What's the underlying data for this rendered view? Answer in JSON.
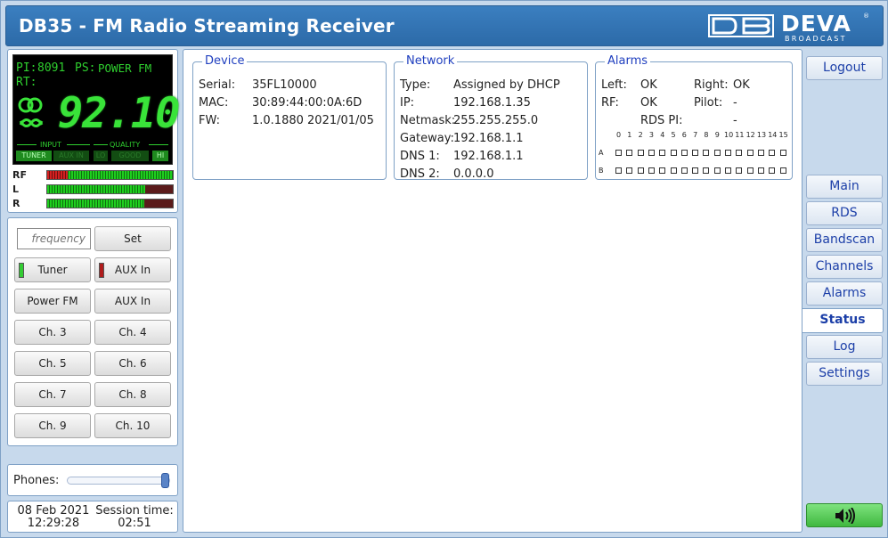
{
  "header": {
    "title": "DB35 - FM Radio Streaming Receiver",
    "logo_text": "DEVA",
    "logo_sub": "BROADCAST",
    "logo_reg": "®"
  },
  "lcd": {
    "pi_label": "PI:",
    "pi_value": "8091",
    "ps_label": "PS:",
    "ps_value": "POWER FM",
    "rt_label": "RT:",
    "frequency": "92.10",
    "input_label": "INPUT",
    "quality_label": "QUALITY",
    "tuner": "TUNER",
    "aux_in": "AUX IN",
    "lo": "LO",
    "good": "GOOD",
    "hi": "HI"
  },
  "meters": [
    {
      "label": "RF",
      "level": 0.16,
      "color": "red"
    },
    {
      "label": "L",
      "level": 0.78,
      "color": "green"
    },
    {
      "label": "R",
      "level": 0.77,
      "color": "green"
    }
  ],
  "controls": {
    "frequency_placeholder": "frequency",
    "set": "Set",
    "tuner": "Tuner",
    "aux_in_toggle": "AUX In",
    "presets": [
      "Power FM",
      "AUX In",
      "Ch. 3",
      "Ch. 4",
      "Ch. 5",
      "Ch. 6",
      "Ch. 7",
      "Ch. 8",
      "Ch. 9",
      "Ch. 10"
    ],
    "tuner_led_color": "#33cc33",
    "aux_led_color": "#b01c1c"
  },
  "phones": {
    "label": "Phones:",
    "level": 0.95
  },
  "clock": {
    "date": "08 Feb 2021",
    "time": "12:29:28",
    "session_label": "Session time:",
    "session_time": "02:51"
  },
  "device": {
    "legend": "Device",
    "serial_label": "Serial:",
    "serial": "35FL10000",
    "mac_label": "MAC:",
    "mac": "30:89:44:00:0A:6D",
    "fw_label": "FW:",
    "fw": "1.0.1880 2021/01/05"
  },
  "network": {
    "legend": "Network",
    "type_label": "Type:",
    "type": "Assigned by DHCP",
    "ip_label": "IP:",
    "ip": "192.168.1.35",
    "netmask_label": "Netmask:",
    "netmask": "255.255.255.0",
    "gateway_label": "Gateway:",
    "gateway": "192.168.1.1",
    "dns1_label": "DNS 1:",
    "dns1": "192.168.1.1",
    "dns2_label": "DNS 2:",
    "dns2": "0.0.0.0"
  },
  "alarms": {
    "legend": "Alarms",
    "left_label": "Left:",
    "left": "OK",
    "right_label": "Right:",
    "right": "OK",
    "rf_label": "RF:",
    "rf": "OK",
    "pilot_label": "Pilot:",
    "pilot": "-",
    "rds_pi_label": "RDS PI:",
    "rds_pi": "-",
    "indices": [
      "0",
      "1",
      "2",
      "3",
      "4",
      "5",
      "6",
      "7",
      "8",
      "9",
      "10",
      "11",
      "12",
      "13",
      "14",
      "15"
    ],
    "row_a": "A",
    "row_b": "B"
  },
  "nav": {
    "logout": "Logout",
    "items": [
      "Main",
      "RDS",
      "Bandscan",
      "Channels",
      "Alarms",
      "Status",
      "Log",
      "Settings"
    ],
    "active": "Status",
    "speaker": "speaker-icon"
  },
  "colors": {
    "header_bg": "#2f70ae",
    "lcd_green": "#39e339",
    "nav_text": "#1c3fa8",
    "speaker_green": "#4cc74c"
  }
}
